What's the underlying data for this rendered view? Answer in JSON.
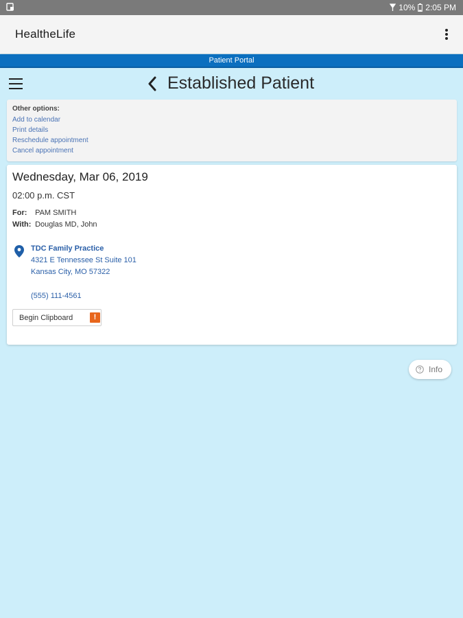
{
  "status_bar": {
    "battery": "10%",
    "time": "2:05 PM"
  },
  "app_bar": {
    "title": "HealtheLife"
  },
  "portal_banner": {
    "label": "Patient Portal"
  },
  "page": {
    "title": "Established Patient"
  },
  "options": {
    "heading": "Other options:",
    "items": [
      {
        "label": "Add to calendar"
      },
      {
        "label": "Print details"
      },
      {
        "label": "Reschedule appointment"
      },
      {
        "label": "Cancel appointment"
      }
    ]
  },
  "appointment": {
    "date": "Wednesday, Mar 06, 2019",
    "time": "02:00 p.m. CST",
    "for_label": "For:",
    "for_value": "PAM SMITH",
    "with_label": "With:",
    "with_value": "Douglas MD, John",
    "location": {
      "name": "TDC Family Practice",
      "address_line1": "4321 E Tennessee St Suite 101",
      "address_line2": "Kansas City, MO 57322",
      "phone": "(555) 111-4561"
    },
    "clipboard_button": "Begin Clipboard",
    "clipboard_badge": "!"
  },
  "info_button": {
    "label": "Info"
  },
  "colors": {
    "background": "#cdeefa",
    "banner": "#0b6fbf",
    "link": "#2a5fa8",
    "badge": "#e8661c"
  }
}
